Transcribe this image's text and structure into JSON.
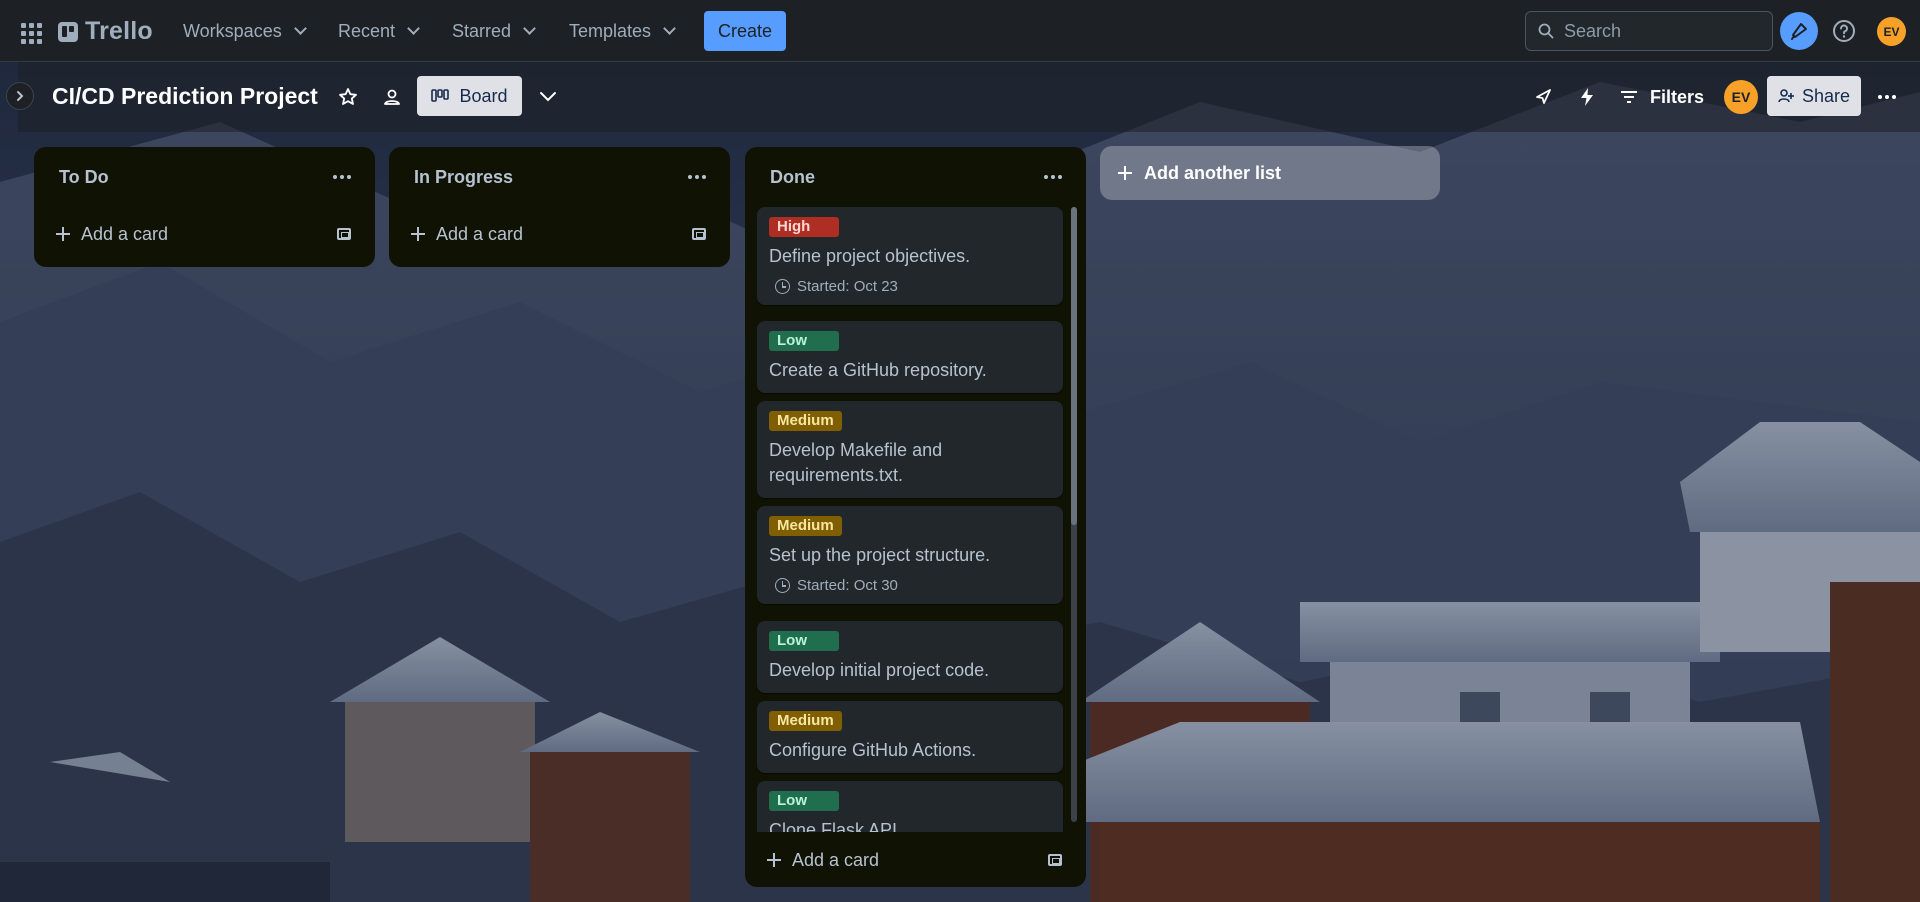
{
  "topbar": {
    "apps_icon": "grid-icon",
    "logo_text": "Trello",
    "menus": [
      "Workspaces",
      "Recent",
      "Starred",
      "Templates"
    ],
    "create_label": "Create",
    "search_placeholder": "Search",
    "user_initials": "EV"
  },
  "board": {
    "title": "CI/CD Prediction Project",
    "view_label": "Board",
    "filters_label": "Filters",
    "share_label": "Share",
    "member_initials": "EV"
  },
  "colors": {
    "accent": "#579dff",
    "avatar": "#f7a128",
    "label_high": "#ae2e24",
    "label_low": "#216e4e",
    "label_medium": "#7f5f01"
  },
  "lists": [
    {
      "title": "To Do",
      "add_label": "Add a card",
      "cards": []
    },
    {
      "title": "In Progress",
      "add_label": "Add a card",
      "cards": []
    },
    {
      "title": "Done",
      "add_label": "Add a card",
      "cards": [
        {
          "label": "High",
          "title": "Define project objectives.",
          "badge": "Started: Oct 23"
        },
        {
          "label": "Low",
          "title": "Create a GitHub repository."
        },
        {
          "label": "Medium",
          "title": "Develop Makefile and requirements.txt."
        },
        {
          "label": "Medium",
          "title": "Set up the project structure.",
          "badge": "Started: Oct 30"
        },
        {
          "label": "Low",
          "title": "Develop initial project code."
        },
        {
          "label": "Medium",
          "title": "Configure GitHub Actions."
        },
        {
          "label": "Low",
          "title": "Clone Flask API"
        }
      ]
    }
  ],
  "add_list_label": "Add another list"
}
